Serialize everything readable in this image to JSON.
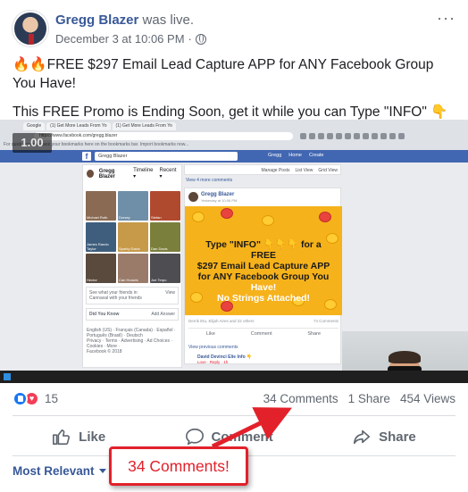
{
  "post": {
    "author": "Gregg Blazer",
    "action": "was live.",
    "date": "December 3 at 10:06 PM",
    "separator": "·",
    "more": "···",
    "line1": "🔥🔥FREE $297 Email Lead Capture APP for ANY Facebook Group You Have!",
    "line2": "This FREE Promo is Ending Soon, get it while you can Type \"INFO\" 👇👇👇"
  },
  "video": {
    "speed": "1.00",
    "browser_tabs": [
      "Google",
      "(1) Get More Leads From Yo",
      "(1) Get More Leads From Yo"
    ],
    "address": "https://www.facebook.com/gregg.blazer",
    "bookmarks_hint": "For quick access, place your bookmarks here on the bookmarks bar. Import bookmarks now...",
    "fb_search": "Gregg Blazer",
    "fb_nav": [
      "Gregg",
      "Home",
      "Create"
    ],
    "profile_name": "Gregg Blazer",
    "profile_tabs": [
      "Timeline ▾",
      "Recent ▾"
    ],
    "toolbar": [
      "Manage Posts",
      "List View",
      "Grid View"
    ],
    "view_more": "View 4 more comments",
    "friends": [
      {
        "name": "Michael Roth",
        "sub": "9 new posts"
      },
      {
        "name": "Dorsey",
        "sub": "4 new posts"
      },
      {
        "name": "Stefan",
        "sub": "9 new posts"
      },
      {
        "name": "James Rando Taylor",
        "sub": "9 new posts"
      },
      {
        "name": "Sparky Davis",
        "sub": "1 new post"
      },
      {
        "name": "Dan Davis",
        "sub": "9 new posts"
      },
      {
        "name": "Hector",
        "sub": "9 new posts"
      },
      {
        "name": "Can Hoowis",
        "sub": "1 new post"
      },
      {
        "name": "Joe Terpo",
        "sub": "9 new posts"
      }
    ],
    "camera_text": "See what your friends in Cannaval with your friends",
    "view_button": "View",
    "did_you_know": "Did You Know",
    "add_answer": "Add Answer",
    "languages": "English (US) · Français (Canada) · Español · Português (Brasil) · Deutsch",
    "footer_links": "Privacy · Terms · Advertising · Ad Choices · Cookies · More ·",
    "copyright": "Facebook © 2018",
    "inner_author": "Gregg Blazer",
    "inner_date": "Yesterday at 10:06 PM",
    "promo": {
      "line1": "Type \"INFO\" 👇👇👇 for a FREE",
      "line2": "$297 Email Lead Capture APP",
      "line3": "for ANY Facebook Group You",
      "line4": "Have!",
      "line5": "No Strings Attached!"
    },
    "inner_likes": "Derrik Etu, Elijah Aires and 22 others",
    "inner_comments": "74 Comments",
    "inner_actions": [
      "Like",
      "Comment",
      "Share"
    ],
    "view_previous": "View previous comments",
    "commenter": "David Devinci Elie Info 👇",
    "comment_actions": "Love · Reply · 1h"
  },
  "stats": {
    "reaction_count": "15",
    "comments": "34 Comments",
    "shares": "1 Share",
    "views": "454 Views"
  },
  "actions": {
    "like": "Like",
    "comment": "Comment",
    "share": "Share"
  },
  "sort": {
    "label": "Most Relevant"
  },
  "annotation": {
    "callout": "34 Comments!",
    "color": "#e2212b"
  },
  "colors": {
    "link": "#385898",
    "muted": "#606770",
    "facebook_blue": "#4267b2",
    "promo_bg": "#f6b21b"
  }
}
